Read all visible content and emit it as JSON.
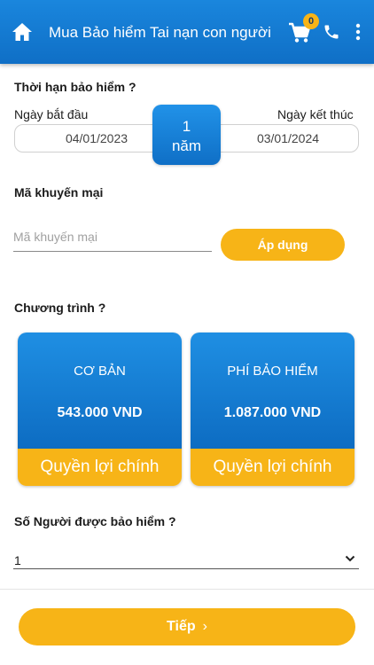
{
  "header": {
    "title": "Mua Bảo hiểm Tai nạn con người",
    "cart_count": "0",
    "icons": [
      "home-icon",
      "cart-icon",
      "phone-icon",
      "more-vertical-icon"
    ]
  },
  "term": {
    "heading": "Thời hạn bảo hiểm ?",
    "start_label": "Ngày bắt đầu",
    "end_label": "Ngày kết thúc",
    "start_date": "04/01/2023",
    "end_date": "03/01/2024",
    "duration_value": "1",
    "duration_unit": "năm"
  },
  "promo": {
    "heading": "Mã khuyến mại",
    "placeholder": "Mã khuyến mại",
    "value": "",
    "apply_label": "Áp dụng"
  },
  "plans": {
    "heading": "Chương trình ?",
    "cards": [
      {
        "name": "CƠ BẢN",
        "price": "543.000 VND",
        "benefit_label": "Quyền lợi chính"
      },
      {
        "name": "PHÍ BẢO HIỂM",
        "price": "1.087.000 VND",
        "benefit_label": "Quyền lợi chính"
      }
    ]
  },
  "insured": {
    "heading": "Số Người được bảo hiểm ?",
    "selected": "1"
  },
  "footer": {
    "next_label": "Tiếp",
    "next_arrow": "›"
  },
  "colors": {
    "primary_blue": "#0f6fc6",
    "accent_yellow": "#f7b417"
  }
}
